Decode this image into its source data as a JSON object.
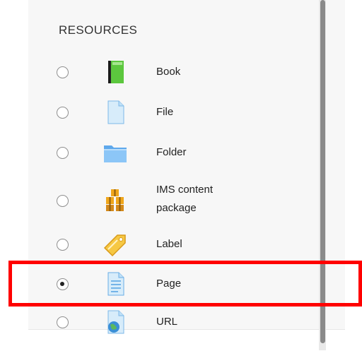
{
  "section": {
    "title": "RESOURCES"
  },
  "items": [
    {
      "label": "Book",
      "icon": "book-icon",
      "selected": false
    },
    {
      "label": "File",
      "icon": "file-icon",
      "selected": false
    },
    {
      "label": "Folder",
      "icon": "folder-icon",
      "selected": false
    },
    {
      "label_line1": "IMS content",
      "label_line2": "package",
      "icon": "ims-package-icon",
      "selected": false
    },
    {
      "label": "Label",
      "icon": "label-tag-icon",
      "selected": false
    },
    {
      "label": "Page",
      "icon": "page-icon",
      "selected": true
    },
    {
      "label": "URL",
      "icon": "url-icon",
      "selected": false
    }
  ],
  "colors": {
    "highlight": "#ff0000",
    "panel_bg": "#f7f7f7"
  }
}
